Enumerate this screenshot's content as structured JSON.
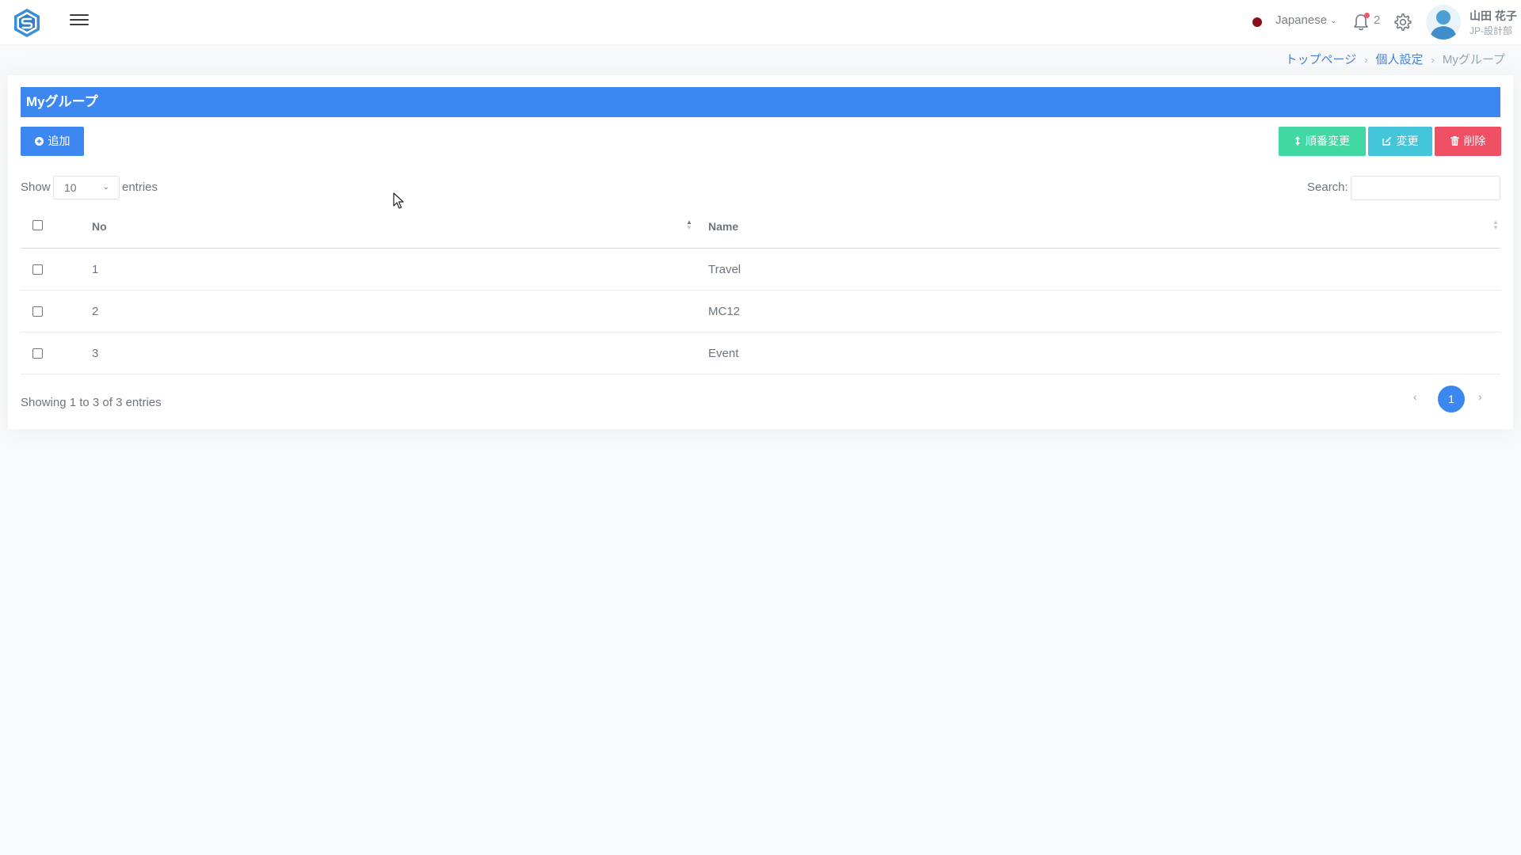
{
  "header": {
    "language": "Japanese",
    "notification_count": "2",
    "user_name": "山田 花子",
    "user_dept": "JP-設計部",
    "colors": {
      "language_dot": "#8b0f1c",
      "accent": "#3c87f0"
    }
  },
  "breadcrumb": {
    "items": [
      "トップページ",
      "個人設定"
    ],
    "active": "Myグループ"
  },
  "card": {
    "title": "Myグループ",
    "buttons": {
      "add": "追加",
      "order": "順番変更",
      "edit": "変更",
      "delete": "削除"
    },
    "show_label": "Show",
    "page_length": "10",
    "entries_label": "entries",
    "search_label": "Search:",
    "search_value": ""
  },
  "table": {
    "columns": [
      "No",
      "Name"
    ],
    "rows": [
      {
        "no": "1",
        "name": "Travel"
      },
      {
        "no": "2",
        "name": "MC12"
      },
      {
        "no": "3",
        "name": "Event"
      }
    ]
  },
  "footer": {
    "info": "Showing 1 to 3 of 3 entries",
    "prev": "‹",
    "current_page": "1",
    "next": "›"
  }
}
